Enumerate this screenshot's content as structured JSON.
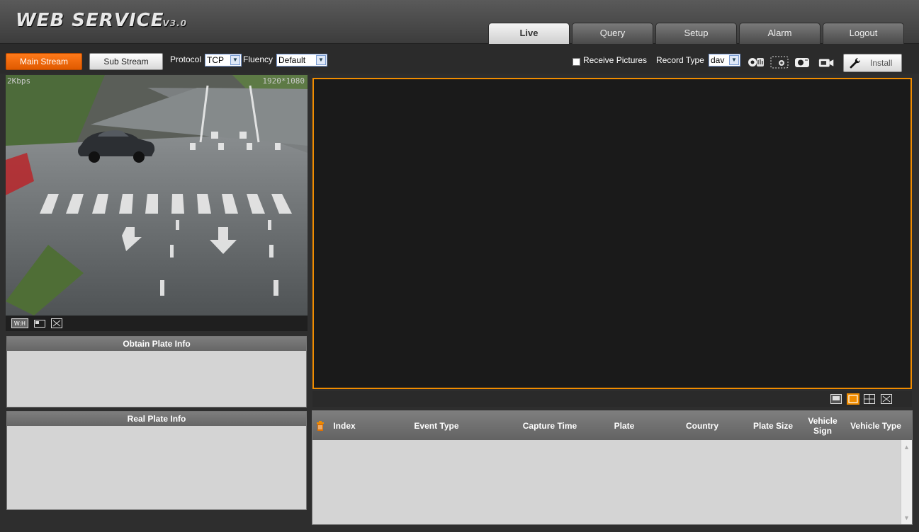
{
  "header": {
    "logo": "WEB SERVICE",
    "version": "V3.0",
    "tabs": [
      {
        "label": "Live",
        "active": true
      },
      {
        "label": "Query"
      },
      {
        "label": "Setup"
      },
      {
        "label": "Alarm"
      },
      {
        "label": "Logout"
      }
    ]
  },
  "toolbar": {
    "main_stream": "Main Stream",
    "sub_stream": "Sub Stream",
    "protocol_label": "Protocol",
    "protocol_value": "TCP",
    "fluency_label": "Fluency",
    "fluency_value": "Default",
    "receive_pictures": "Receive Pictures",
    "record_type_label": "Record Type",
    "record_type_value": "dav",
    "install": "Install"
  },
  "left_video": {
    "bitrate": "2Kbps",
    "resolution": "1920*1080"
  },
  "panels": {
    "obtain_plate": "Obtain Plate Info",
    "real_plate": "Real Plate Info"
  },
  "table": {
    "columns": [
      "Index",
      "Event Type",
      "Capture Time",
      "Plate",
      "Country",
      "Plate Size",
      "Vehicle Sign",
      "Vehicle Type"
    ]
  },
  "colors": {
    "accent": "#f08c00",
    "active_button": "#f26a0c"
  }
}
